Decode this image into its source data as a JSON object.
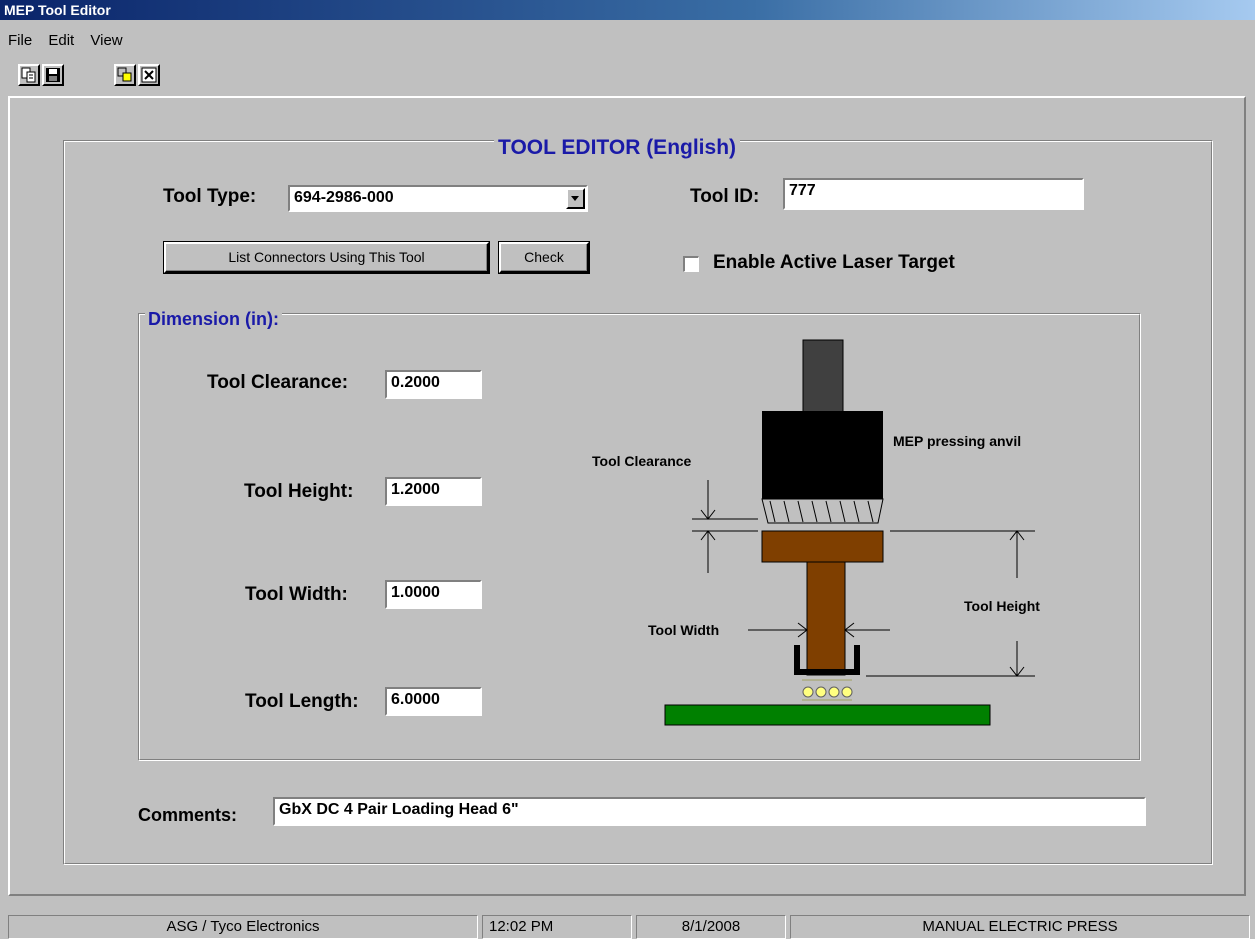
{
  "window": {
    "title": "MEP Tool Editor"
  },
  "menu": [
    "File",
    "Edit",
    "View"
  ],
  "toolbar": [
    {
      "icon": "copy-icon"
    },
    {
      "icon": "save-icon"
    },
    {
      "icon": "paste-icon"
    },
    {
      "icon": "delete-icon"
    }
  ],
  "editor": {
    "heading": "TOOL EDITOR (English)",
    "tool_type_label": "Tool Type:",
    "tool_type_value": "694-2986-000",
    "tool_id_label": "Tool ID:",
    "tool_id_value": "777",
    "list_connectors_button": "List Connectors Using This Tool",
    "check_button": "Check",
    "laser_target_label": "Enable Active Laser Target",
    "laser_target_checked": false
  },
  "dimension": {
    "group_label": "Dimension (in):",
    "clearance_label": "Tool Clearance:",
    "clearance_value": "0.2000",
    "height_label": "Tool Height:",
    "height_value": "1.2000",
    "width_label": "Tool Width:",
    "width_value": "1.0000",
    "length_label": "Tool Length:",
    "length_value": "6.0000"
  },
  "diagram": {
    "anvil_label": "MEP pressing anvil",
    "clearance_label": "Tool Clearance",
    "height_label": "Tool Height",
    "width_label": "Tool Width",
    "colors": {
      "anvil": "#000000",
      "shaft": "#404040",
      "tool": "#7f3f00",
      "board": "#008000",
      "pins": "#ffff80"
    }
  },
  "comments": {
    "label": "Comments:",
    "value": "GbX DC 4 Pair Loading Head 6\""
  },
  "statusbar": {
    "company": "ASG / Tyco Electronics",
    "time": "12:02 PM",
    "date": "8/1/2008",
    "mode": "MANUAL ELECTRIC PRESS"
  }
}
